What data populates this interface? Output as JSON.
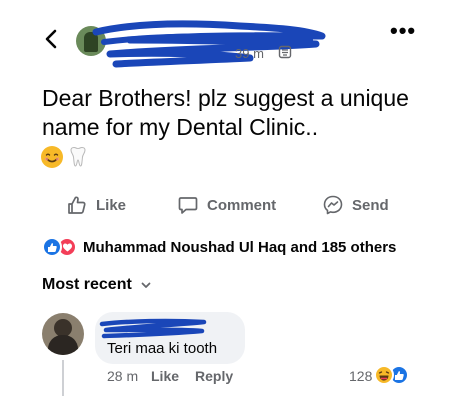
{
  "header": {
    "time": "39 m",
    "separator": "·",
    "back_icon": "chevron-left-icon",
    "privacy_icon": "globe-icon",
    "more_icon": "more-horizontal-icon"
  },
  "post": {
    "text": "Dear Brothers! plz suggest a unique name for my Dental Clinic..",
    "emojis": [
      "smiling-face-emoji",
      "tooth-emoji"
    ]
  },
  "actions": {
    "like": "Like",
    "comment": "Comment",
    "send": "Send"
  },
  "reactions": {
    "summary": "Muhammad Noushad Ul Haq and 185 others",
    "types": [
      "like",
      "love"
    ]
  },
  "sort": {
    "label": "Most recent"
  },
  "comment": {
    "text": "Teri maa ki tooth",
    "time": "28 m",
    "like": "Like",
    "reply": "Reply",
    "reaction_count": "128",
    "reaction_types": [
      "haha",
      "like"
    ]
  },
  "colors": {
    "scribble": "#1a46b8",
    "accent": "#1b74e4",
    "love": "#f33e58",
    "secondary_text": "#65676b"
  }
}
